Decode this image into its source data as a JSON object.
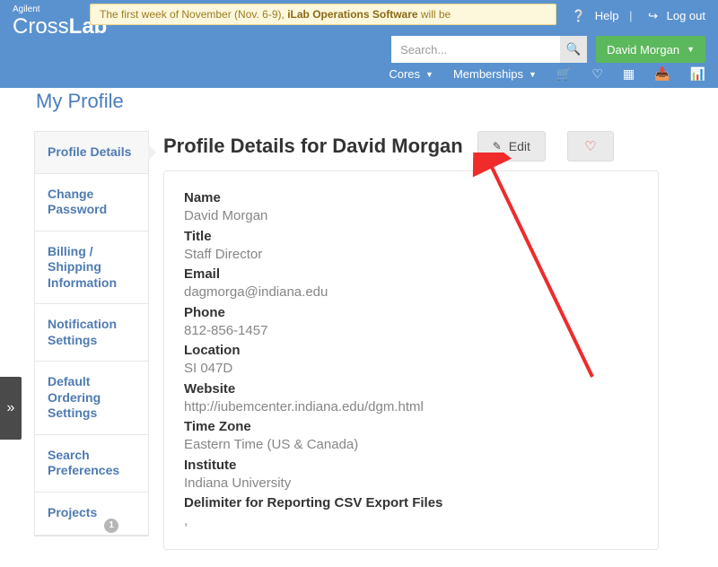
{
  "banner": {
    "prefix": "The first week of November (Nov. 6-9), ",
    "bold": "iLab Operations Software",
    "suffix": " will be"
  },
  "header": {
    "help": "Help",
    "logout": "Log out",
    "search_placeholder": "Search...",
    "user_name": "David Morgan"
  },
  "nav": {
    "cores": "Cores",
    "memberships": "Memberships"
  },
  "page": {
    "title": "My Profile"
  },
  "sidebar": {
    "items": [
      "Profile Details",
      "Change Password",
      "Billing / Shipping Information",
      "Notification Settings",
      "Default Ordering Settings",
      "Search Preferences",
      "Projects"
    ],
    "projects_badge": "1"
  },
  "content": {
    "heading": "Profile Details for David Morgan",
    "edit": "Edit"
  },
  "profile": {
    "name_label": "Name",
    "name": "David Morgan",
    "title_label": "Title",
    "title": "Staff Director",
    "email_label": "Email",
    "email": "dagmorga@indiana.edu",
    "phone_label": "Phone",
    "phone": "812-856-1457",
    "location_label": "Location",
    "location": "SI 047D",
    "website_label": "Website",
    "website": "http://iubemcenter.indiana.edu/dgm.html",
    "timezone_label": "Time Zone",
    "timezone": "Eastern Time (US & Canada)",
    "institute_label": "Institute",
    "institute": "Indiana University",
    "delimiter_label": "Delimiter for Reporting CSV Export Files",
    "delimiter": ","
  }
}
